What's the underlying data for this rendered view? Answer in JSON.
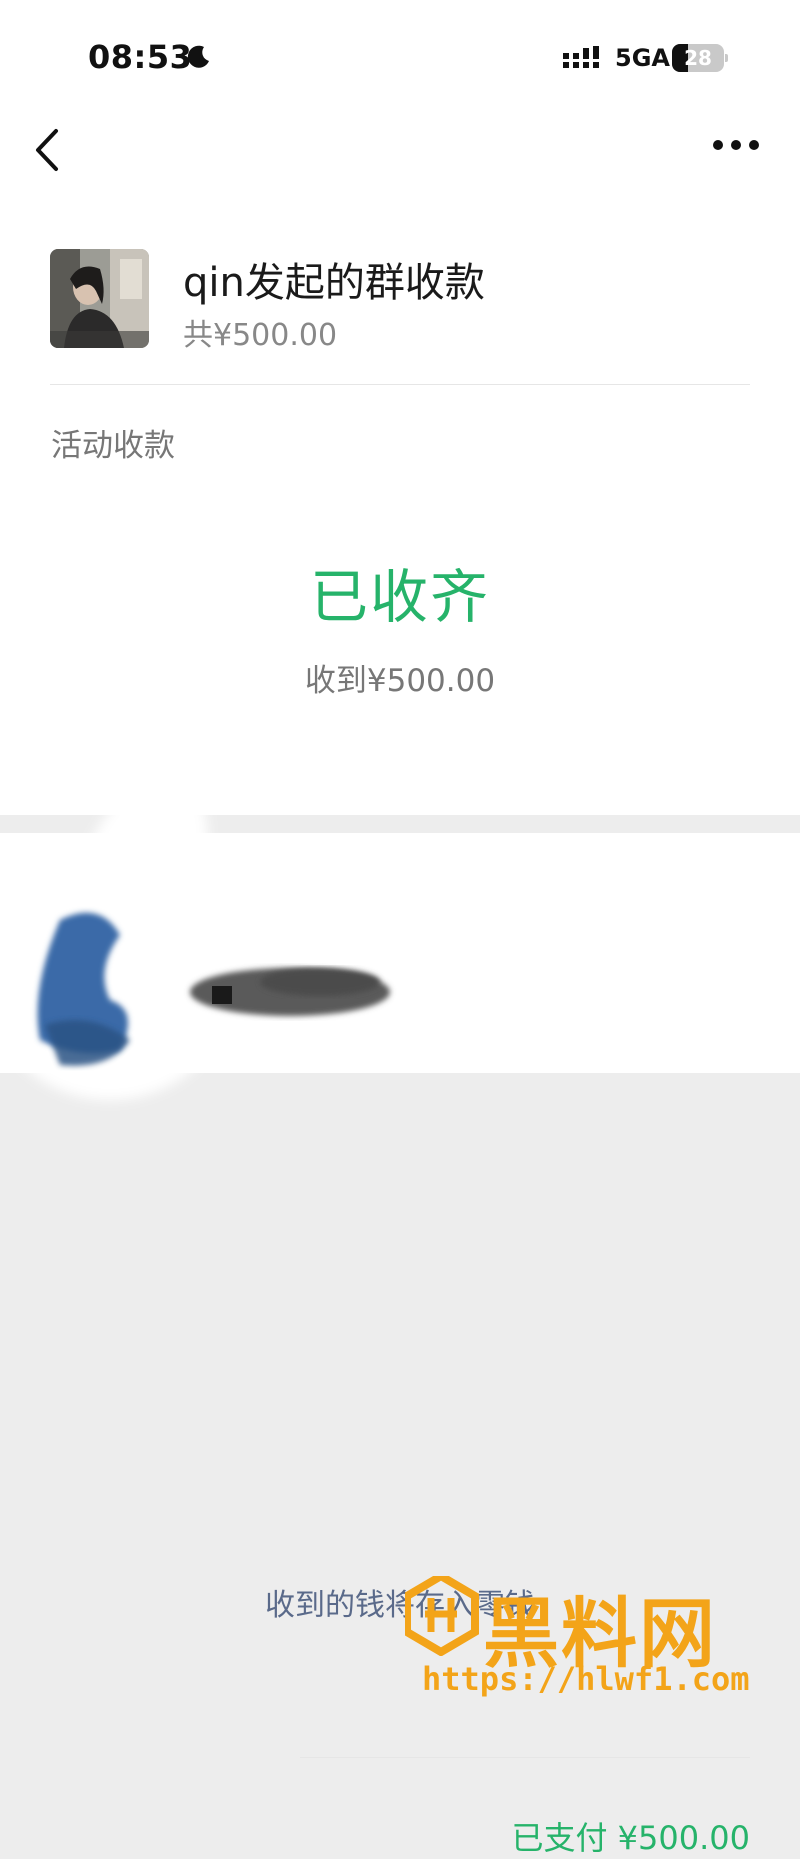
{
  "status_bar": {
    "time": "08:53",
    "network": "5GA",
    "battery": "28"
  },
  "header": {
    "title": "qin发起的群收款",
    "total": "共¥500.00"
  },
  "activity": {
    "label": "活动收款",
    "status": "已收齐",
    "received": "收到¥500.00"
  },
  "payer": {
    "paid": "已支付 ¥500.00"
  },
  "footer": {
    "note": "收到的钱将存入零钱"
  },
  "watermark": {
    "brand": "黑料网",
    "url": "https://hlwf1.com"
  },
  "colors": {
    "accent_green": "#26b36a",
    "watermark_orange": "#f3a419"
  }
}
